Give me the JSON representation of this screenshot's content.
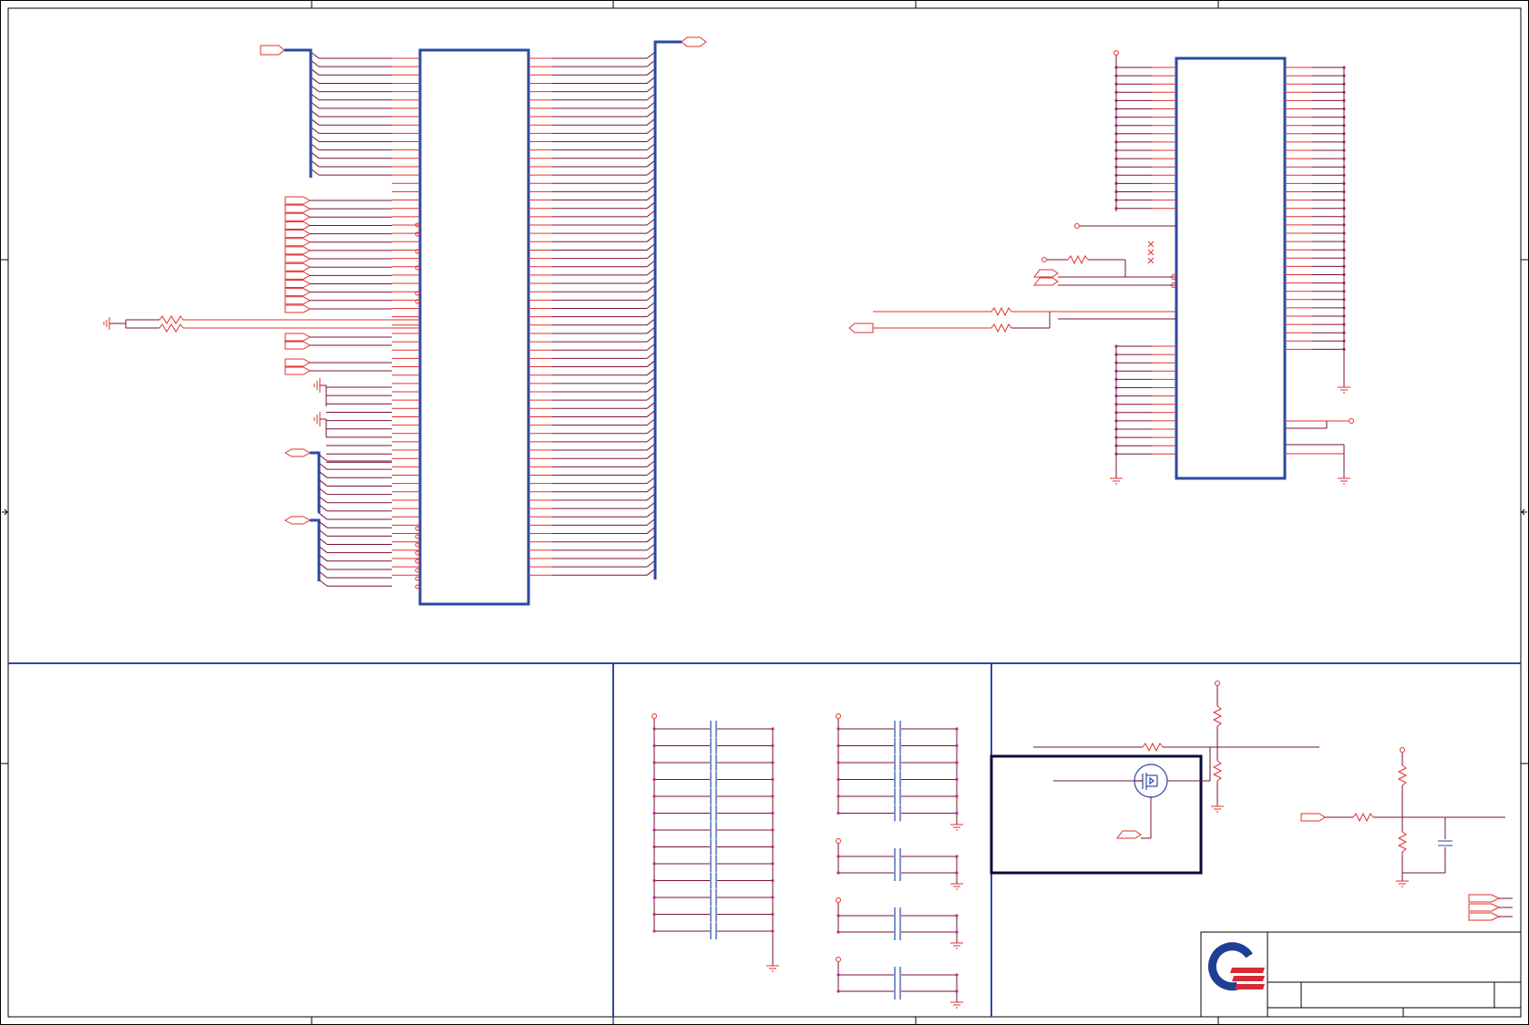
{
  "sheet": {
    "colors": {
      "frame": "#000000",
      "section_border": "#2b4aa3",
      "chip_outline": "#2b4aa3",
      "bus": "#2b4aa3",
      "wire": "#e0302e",
      "net": "#7a1036",
      "junction": "#c026a0",
      "highlight_box": "#0b0b3a",
      "logo_blue": "#1f3f95",
      "logo_red": "#d62b35"
    },
    "icons": {
      "logo": "company-logo-icon",
      "mosfet": "mosfet-transistor-icon",
      "ground": "ground-symbol-icon",
      "resistor": "resistor-icon",
      "capacitor": "capacitor-icon",
      "port": "net-port-icon"
    }
  }
}
